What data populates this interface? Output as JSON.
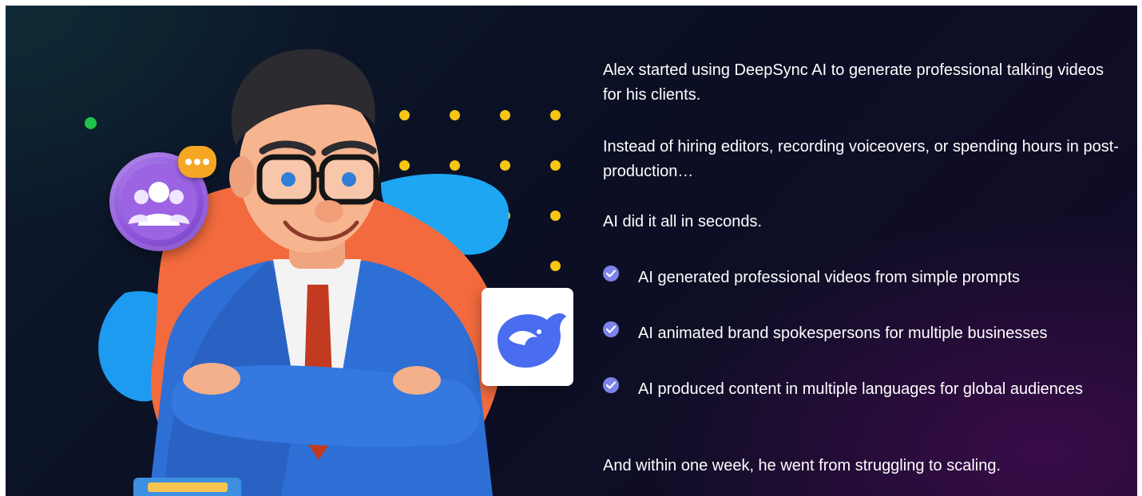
{
  "story": {
    "intro": "Alex started using DeepSync AI to generate professional talking videos for his clients.",
    "instead": "Instead of hiring editors, recording voiceovers, or spending hours in post-production…",
    "result": "AI did it all in seconds.",
    "benefits": [
      "AI generated professional videos from simple prompts",
      "AI animated brand spokespersons for multiple businesses",
      "AI produced content in multiple languages for global audiences"
    ],
    "outcome": "And within one week, he went from struggling to scaling."
  },
  "icons": {
    "check": "check-circle-icon",
    "team": "team-group-icon",
    "chat": "chat-bubble-icon",
    "logo": "whale-logo-icon"
  },
  "colors": {
    "check_badge": "#7c84e8",
    "accent_yellow": "#f7c514",
    "accent_orange": "#f26a3d",
    "accent_blue": "#1d9bf0",
    "badge_purple": "#9c63e3"
  }
}
